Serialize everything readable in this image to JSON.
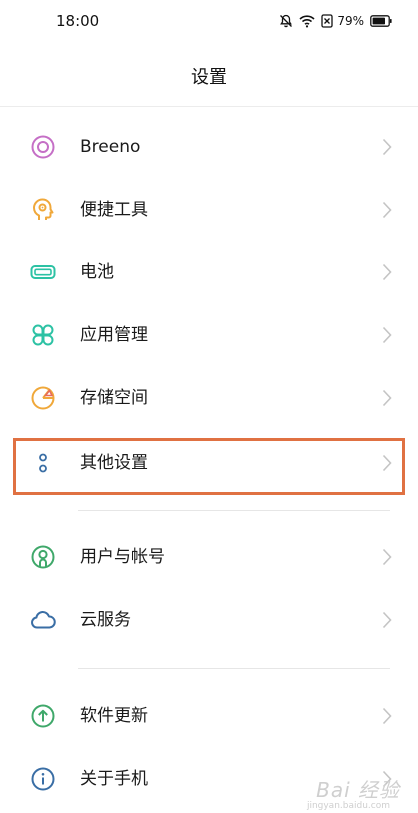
{
  "status_bar": {
    "time": "18:00",
    "battery_percent": "79%",
    "icons": [
      "mute-bell-icon",
      "wifi-icon",
      "sim-x-icon",
      "battery-icon"
    ]
  },
  "header": {
    "title": "设置"
  },
  "menu": {
    "items": [
      {
        "label": "Breeno",
        "icon": "breeno-icon",
        "icon_color": "#c56fc6"
      },
      {
        "label": "便捷工具",
        "icon": "head-tool-icon",
        "icon_color": "#f0a83a"
      },
      {
        "label": "电池",
        "icon": "battery-icon",
        "icon_color": "#2cc2a4"
      },
      {
        "label": "应用管理",
        "icon": "apps-grid-icon",
        "icon_color": "#2cc2a4"
      },
      {
        "label": "存储空间",
        "icon": "pie-chart-icon",
        "icon_color": "#f0a83a"
      },
      {
        "label": "其他设置",
        "icon": "dots-icon",
        "icon_color": "#3a6ea5"
      },
      {
        "label": "用户与帐号",
        "icon": "user-icon",
        "icon_color": "#3fa86a"
      },
      {
        "label": "云服务",
        "icon": "cloud-icon",
        "icon_color": "#3a6ea5"
      },
      {
        "label": "软件更新",
        "icon": "update-arrow-icon",
        "icon_color": "#3fa86a"
      },
      {
        "label": "关于手机",
        "icon": "info-icon",
        "icon_color": "#3a6ea5"
      }
    ]
  },
  "watermark": {
    "text": "Bai 经验",
    "sub": "jingyan.baidu.com"
  },
  "colors": {
    "highlight": "#e07142",
    "chevron": "#c4c4c4"
  }
}
